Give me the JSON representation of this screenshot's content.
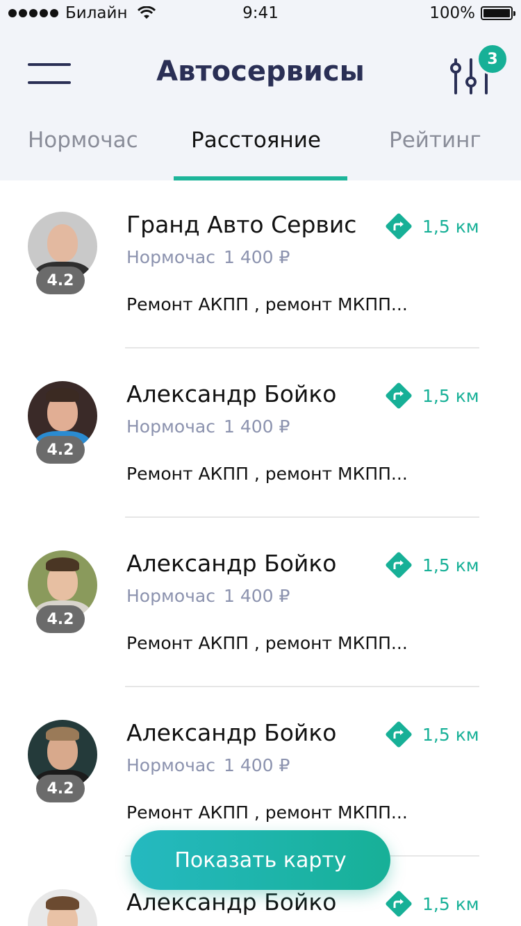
{
  "status_bar": {
    "carrier": "Билайн",
    "time": "9:41",
    "battery": "100%"
  },
  "header": {
    "title": "Автосервисы",
    "filter_badge": "3"
  },
  "tabs": [
    {
      "label": "Нормочас"
    },
    {
      "label": "Расстояние"
    },
    {
      "label": "Рейтинг"
    }
  ],
  "active_tab": "Расстояние",
  "colors": {
    "accent": "#17b097",
    "title": "#2a2f55",
    "muted": "#8b92ae",
    "header_bg": "#f2f4f9"
  },
  "items": [
    {
      "name": "Гранд Авто Сервис",
      "rating": "4.2",
      "price_label": "Нормочас",
      "price": "1 400 ₽",
      "distance": "1,5 км",
      "services": "Ремонт АКПП , ремонт МКПП..."
    },
    {
      "name": "Александр Бойко",
      "rating": "4.2",
      "price_label": "Нормочас",
      "price": "1 400 ₽",
      "distance": "1,5 км",
      "services": "Ремонт АКПП , ремонт МКПП..."
    },
    {
      "name": "Александр Бойко",
      "rating": "4.2",
      "price_label": "Нормочас",
      "price": "1 400 ₽",
      "distance": "1,5 км",
      "services": "Ремонт АКПП , ремонт МКПП..."
    },
    {
      "name": "Александр Бойко",
      "rating": "4.2",
      "price_label": "Нормочас",
      "price": "1 400 ₽",
      "distance": "1,5 км",
      "services": "Ремонт АКПП , ремонт МКПП..."
    },
    {
      "name": "Александр Бойко",
      "distance": "1,5 км"
    }
  ],
  "map_button": "Показать карту",
  "icons": {
    "menu": "hamburger-menu-icon",
    "filter": "sliders-filter-icon",
    "distance": "direction-turn-icon"
  }
}
